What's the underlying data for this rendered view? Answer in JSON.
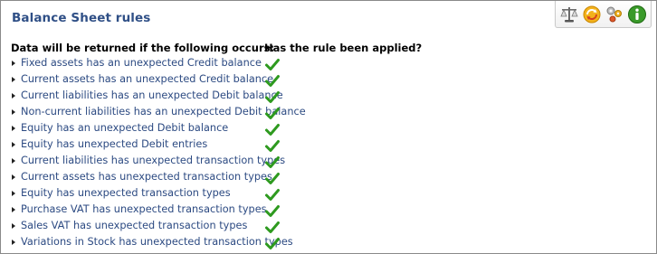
{
  "page": {
    "title": "Balance Sheet rules"
  },
  "toolbar": {
    "buttons": [
      {
        "icon": "scales-icon"
      },
      {
        "icon": "refresh-icon"
      },
      {
        "icon": "settings-icon"
      },
      {
        "icon": "info-icon"
      }
    ]
  },
  "columns": {
    "condition_header": "Data will be returned if the following occurs:",
    "applied_header": "Has the rule been applied?"
  },
  "rules": [
    {
      "label": "Fixed assets has an unexpected Credit balance",
      "applied": true
    },
    {
      "label": "Current assets has an unexpected Credit balance",
      "applied": true
    },
    {
      "label": "Current liabilities has an unexpected Debit balance",
      "applied": true
    },
    {
      "label": "Non-current liabilities has an unexpected Debit balance",
      "applied": true
    },
    {
      "label": "Equity has an unexpected Debit balance",
      "applied": true
    },
    {
      "label": "Equity has unexpected Debit entries",
      "applied": true
    },
    {
      "label": "Current liabilities has unexpected transaction types",
      "applied": true
    },
    {
      "label": "Current assets has unexpected transaction types",
      "applied": true
    },
    {
      "label": "Equity has unexpected transaction types",
      "applied": true
    },
    {
      "label": "Purchase VAT has unexpected transaction types",
      "applied": true
    },
    {
      "label": "Sales VAT has unexpected transaction types",
      "applied": true
    },
    {
      "label": "Variations in Stock has unexpected transaction types",
      "applied": true
    }
  ],
  "colors": {
    "accent": "#2f4f86",
    "link": "#2c4a82",
    "check": "#2e9a1f"
  }
}
